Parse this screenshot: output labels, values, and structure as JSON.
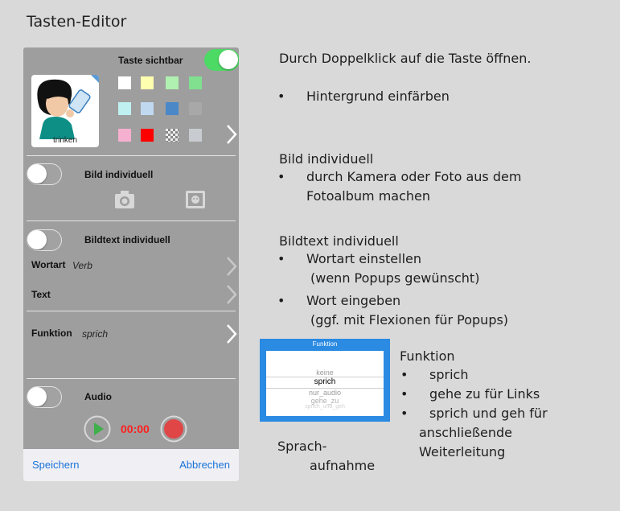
{
  "slide": {
    "title": "Tasten-Editor"
  },
  "panel": {
    "visible_label": "Taste sichtbar",
    "visible_on": true,
    "key_caption": "trinken",
    "swatches": [
      "#ffffff",
      "#ffffb0",
      "#b0f0b0",
      "#80e090",
      "#c0f0f0",
      "#c0d8f0",
      "#4a88c8",
      "#a8a8a8",
      "#f5b0d0",
      "#ff0000",
      "checker",
      "#c8ccd0"
    ],
    "image_toggle_label": "Bild individuell",
    "imagetext_toggle_label": "Bildtext individuell",
    "wortart_label": "Wortart",
    "wortart_value": "Verb",
    "text_label": "Text",
    "funktion_label": "Funktion",
    "funktion_value": "sprich",
    "audio_label": "Audio",
    "audio_time": "00:00",
    "save_label": "Speichern",
    "cancel_label": "Abbrechen"
  },
  "notes": {
    "open_hint": "Durch Doppelklick auf die Taste öffnen.",
    "bg_bullet": "Hintergrund einfärben",
    "bild_heading": "Bild individuell",
    "bild_line1": "durch Kamera oder Foto aus dem",
    "bild_line2": "Fotoalbum machen",
    "bildtext_heading": "Bildtext individuell",
    "bt_b1_line1": "Wortart einstellen",
    "bt_b1_line2": "(wenn Popups gewünscht)",
    "bt_b2_line1": "Wort eingeben",
    "bt_b2_line2": "(ggf. mit Flexionen für Popups)",
    "funktion_heading": "Funktion",
    "fn_b1": "sprich",
    "fn_b2": "gehe zu für Links",
    "fn_b3_line1": "sprich und geh für",
    "fn_b3_line2": "anschließende",
    "fn_b3_line3": "Weiterleitung",
    "sprach_line1": "Sprach-",
    "sprach_line2": "aufnahme",
    "bullet": "•"
  },
  "picker": {
    "title": "Funktion",
    "options": [
      "keine",
      "sprich",
      "nur_audio",
      "gehe_zu",
      "sprich_und_geh"
    ]
  }
}
